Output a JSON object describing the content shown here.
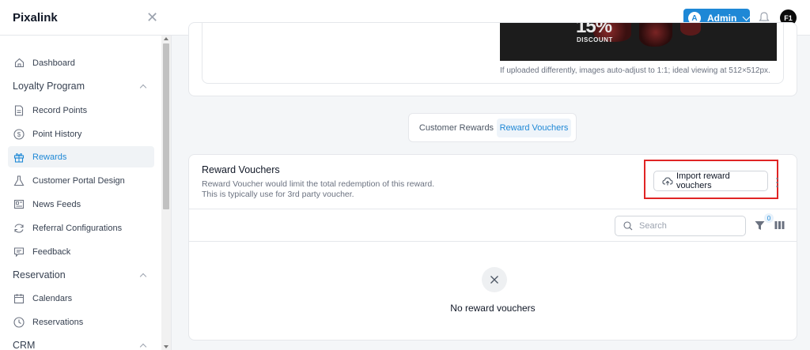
{
  "app": {
    "title": "Pixalink"
  },
  "header": {
    "account_initial": "A",
    "account_label": "Admin",
    "user_initials": "F1"
  },
  "sidebar": {
    "items": [
      {
        "label": "Dashboard",
        "icon": "home-icon"
      },
      {
        "label": "Record Points",
        "icon": "document-icon"
      },
      {
        "label": "Point History",
        "icon": "dollar-circle-icon"
      },
      {
        "label": "Rewards",
        "icon": "gift-icon",
        "active": true
      },
      {
        "label": "Customer Portal Design",
        "icon": "flask-icon"
      },
      {
        "label": "News Feeds",
        "icon": "newspaper-icon"
      },
      {
        "label": "Referral Configurations",
        "icon": "refresh-icon"
      },
      {
        "label": "Feedback",
        "icon": "comment-icon"
      },
      {
        "label": "Calendars",
        "icon": "calendar-icon"
      },
      {
        "label": "Reservations",
        "icon": "clock-icon"
      }
    ],
    "sections": {
      "loyalty": "Loyalty Program",
      "reservation": "Reservation",
      "crm": "CRM"
    }
  },
  "image_card": {
    "promo_percent": "15%",
    "promo_word": "DISCOUNT",
    "hint": "If uploaded differently, images auto-adjust to 1:1; ideal viewing at 512×512px."
  },
  "tabs": [
    {
      "label": "Customer Rewards",
      "active": false
    },
    {
      "label": "Reward Vouchers",
      "active": true
    }
  ],
  "vouchers": {
    "title": "Reward Vouchers",
    "description_line1": "Reward Voucher would limit the total redemption of this reward.",
    "description_line2": "This is typically use for 3rd party voucher.",
    "import_label": "Import reward vouchers",
    "search_placeholder": "Search",
    "filter_count": "0",
    "empty_text": "No reward vouchers"
  },
  "colors": {
    "accent": "#1e88d6",
    "highlight": "#e02424",
    "active_bg": "#f0f3f6"
  }
}
